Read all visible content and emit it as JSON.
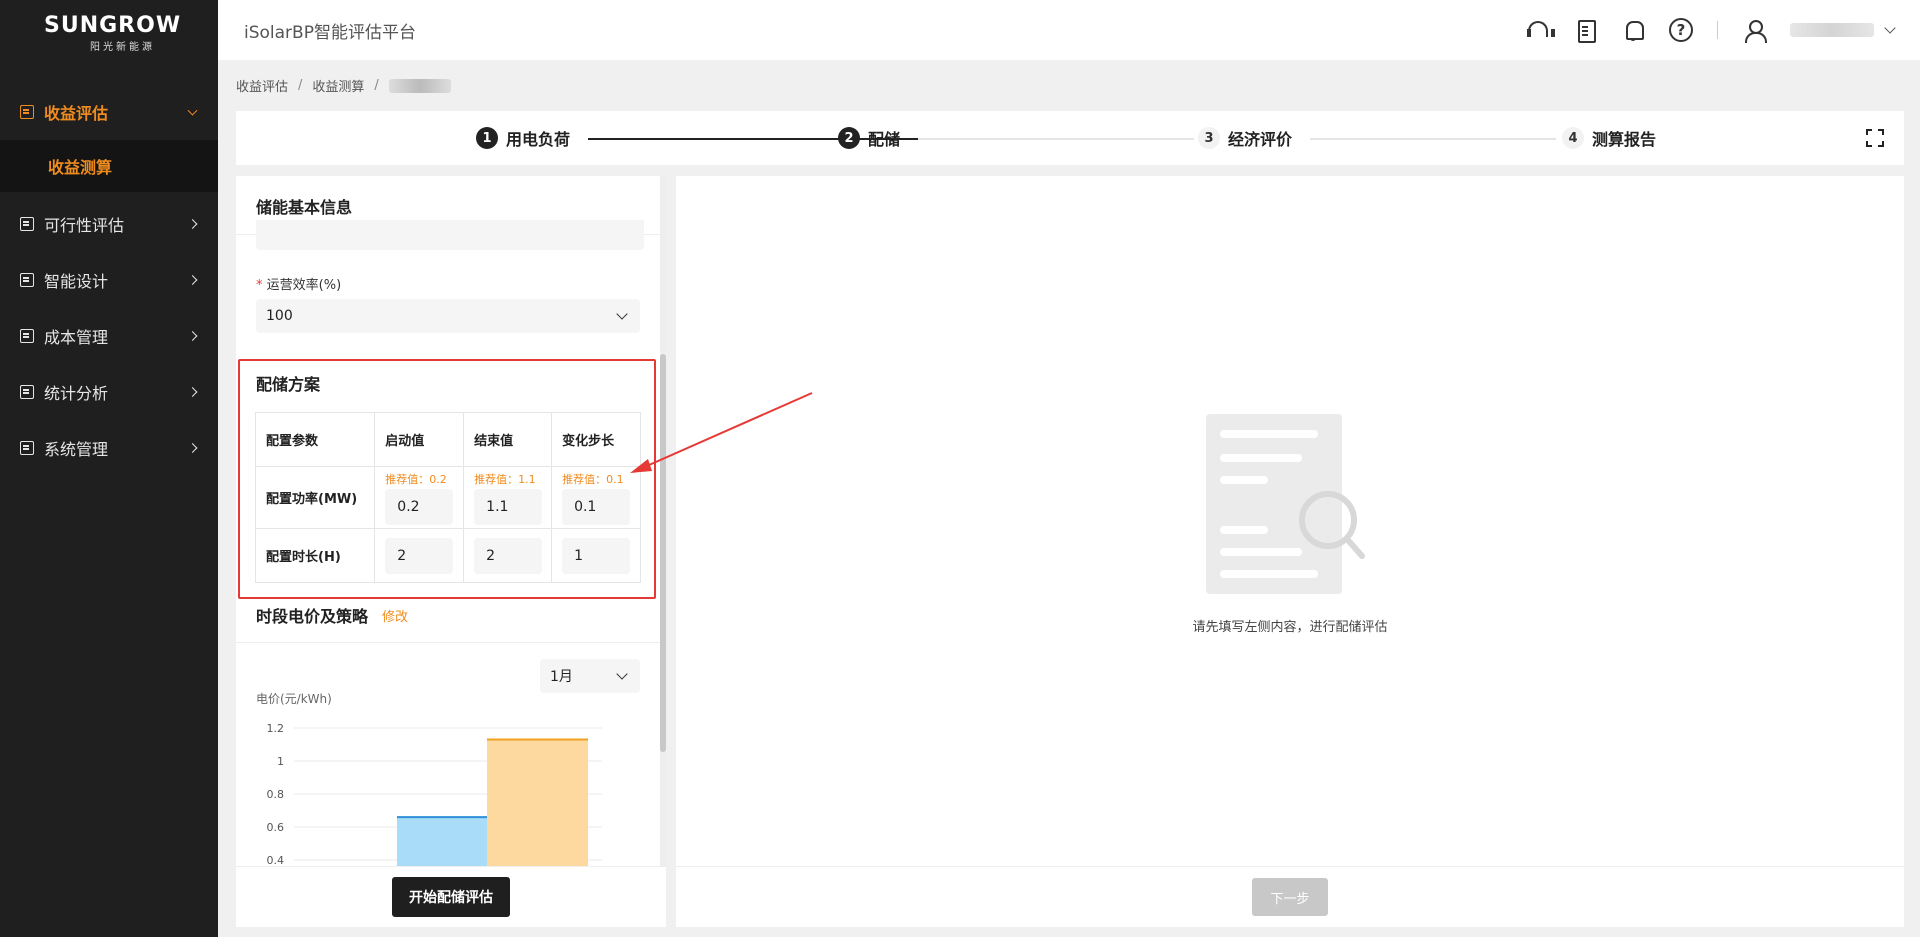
{
  "app": {
    "title": "iSolarBP智能评估平台"
  },
  "logo": {
    "brand": "SUNGROW",
    "sub": "阳光新能源"
  },
  "sidebar": {
    "items": [
      {
        "label": "收益评估",
        "open": true,
        "children": [
          {
            "label": "收益测算"
          }
        ]
      },
      {
        "label": "可行性评估"
      },
      {
        "label": "智能设计"
      },
      {
        "label": "成本管理"
      },
      {
        "label": "统计分析"
      },
      {
        "label": "系统管理"
      }
    ]
  },
  "breadcrumb": {
    "items": [
      "收益评估",
      "收益测算"
    ],
    "separator": "/"
  },
  "steps": [
    {
      "num": "1",
      "label": "用电负荷",
      "state": "done"
    },
    {
      "num": "2",
      "label": "配储",
      "state": "active"
    },
    {
      "num": "3",
      "label": "经济评价",
      "state": "pending"
    },
    {
      "num": "4",
      "label": "测算报告",
      "state": "pending"
    }
  ],
  "storage_info": {
    "title": "储能基本信息",
    "efficiency": {
      "required_mark": "*",
      "label": "运营效率(%)",
      "value": "100"
    }
  },
  "plan": {
    "title": "配储方案",
    "headers": [
      "配置参数",
      "启动值",
      "结束值",
      "变化步长"
    ],
    "rows": [
      {
        "param": "配置功率(MW)",
        "hints": [
          "推荐值：0.2",
          "推荐值：1.1",
          "推荐值：0.1"
        ],
        "values": [
          "0.2",
          "1.1",
          "0.1"
        ]
      },
      {
        "param": "配置时长(H)",
        "hints": [],
        "values": [
          "2",
          "2",
          "1"
        ]
      }
    ]
  },
  "tariff": {
    "title": "时段电价及策略",
    "edit_label": "修改",
    "month": "1月"
  },
  "chart_data": {
    "type": "bar",
    "ylabel": "电价(元/kWh)",
    "yticks": [
      "1.2",
      "1",
      "0.8",
      "0.6",
      "0.4"
    ],
    "ylim": [
      0.4,
      1.2
    ],
    "series": [
      {
        "color": "#a8dcf8",
        "edge": "#2f8fd8",
        "value": 0.66
      },
      {
        "color": "#fdd9a0",
        "edge": "#f0a020",
        "value": 1.13
      }
    ]
  },
  "buttons": {
    "start": "开始配储评估",
    "next": "下一步"
  },
  "empty_state": {
    "message": "请先填写左侧内容，进行配储评估"
  },
  "colors": {
    "accent": "#f08c1e",
    "dark": "#1f1f1f",
    "annotation": "#e53935"
  }
}
